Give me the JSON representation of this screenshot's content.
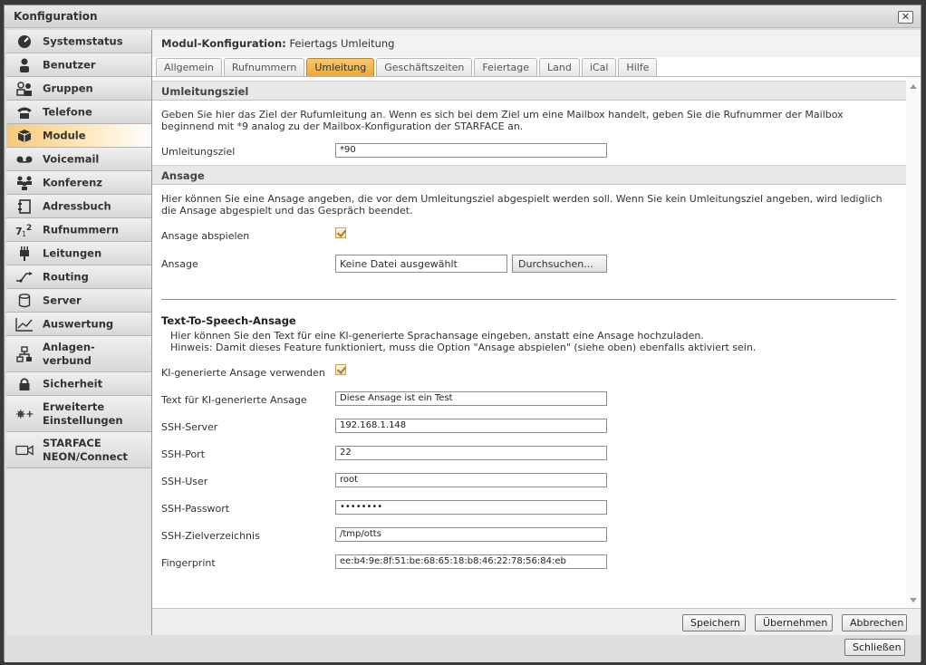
{
  "window": {
    "title": "Konfiguration",
    "close_glyph": "✕"
  },
  "sidebar": {
    "items": [
      {
        "label": "Systemstatus",
        "icon": "gauge-icon"
      },
      {
        "label": "Benutzer",
        "icon": "user-icon"
      },
      {
        "label": "Gruppen",
        "icon": "group-icon"
      },
      {
        "label": "Telefone",
        "icon": "phone-icon"
      },
      {
        "label": "Module",
        "icon": "module-icon",
        "active": true
      },
      {
        "label": "Voicemail",
        "icon": "voicemail-icon"
      },
      {
        "label": "Konferenz",
        "icon": "conference-icon"
      },
      {
        "label": "Adressbuch",
        "icon": "addressbook-icon"
      },
      {
        "label": "Rufnummern",
        "icon": "numbers-icon"
      },
      {
        "label": "Leitungen",
        "icon": "line-icon"
      },
      {
        "label": "Routing",
        "icon": "routing-icon"
      },
      {
        "label": "Server",
        "icon": "server-icon"
      },
      {
        "label": "Auswertung",
        "icon": "chart-icon"
      },
      {
        "label_line1": "Anlagen-",
        "label_line2": "verbund",
        "icon": "network-icon"
      },
      {
        "label": "Sicherheit",
        "icon": "lock-icon"
      },
      {
        "label_line1": "Erweiterte",
        "label_line2": "Einstellungen",
        "icon": "advanced-settings-icon"
      },
      {
        "label_line1": "STARFACE",
        "label_line2": "NEON/Connect",
        "icon": "video-icon"
      }
    ]
  },
  "header": {
    "prefix": "Modul-Konfiguration:",
    "module_name": "Feiertags Umleitung"
  },
  "tabs": [
    {
      "label": "Allgemein"
    },
    {
      "label": "Rufnummern"
    },
    {
      "label": "Umleitung",
      "active": true
    },
    {
      "label": "Geschäftszeiten"
    },
    {
      "label": "Feiertage"
    },
    {
      "label": "Land"
    },
    {
      "label": "iCal"
    },
    {
      "label": "Hilfe"
    }
  ],
  "umleitung": {
    "section_title": "Umleitungsziel",
    "desc_line1": "Geben Sie hier das Ziel der Rufumleitung an. Wenn es sich bei dem Ziel um eine Mailbox handelt, geben Sie die Rufnummer der Mailbox",
    "desc_line2": "beginnend mit *9 analog zu der Mailbox-Konfiguration der STARFACE an.",
    "field_label": "Umleitungsziel",
    "field_value": "*90"
  },
  "ansage": {
    "section_title": "Ansage",
    "desc_line1": "Hier können Sie eine Ansage angeben, die vor dem Umleitungsziel abgespielt werden soll. Wenn Sie kein Umleitungsziel angeben, wird lediglich",
    "desc_line2": "die Ansage abgespielt und das Gespräch beendet.",
    "play_label": "Ansage abspielen",
    "play_checked": true,
    "file_label": "Ansage",
    "file_value": "Keine Datei ausgewählt",
    "browse_label": "Durchsuchen..."
  },
  "tts": {
    "title": "Text-To-Speech-Ansage",
    "desc_line1": "Hier können Sie den Text für eine KI-generierte Sprachansage eingeben, anstatt eine Ansage hochzuladen.",
    "desc_line2": "Hinweis: Damit dieses Feature funktioniert, muss die Option \"Ansage abspielen\" (siehe oben) ebenfalls aktiviert sein.",
    "use_label": "KI-generierte Ansage verwenden",
    "use_checked": true,
    "fields": [
      {
        "label": "Text für KI-generierte Ansage",
        "value": "Diese Ansage ist ein Test"
      },
      {
        "label": "SSH-Server",
        "value": "192.168.1.148"
      },
      {
        "label": "SSH-Port",
        "value": "22"
      },
      {
        "label": "SSH-User",
        "value": "root"
      },
      {
        "label": "SSH-Passwort",
        "value": "••••••••"
      },
      {
        "label": "SSH-Zielverzeichnis",
        "value": "/tmp/otts"
      },
      {
        "label": "Fingerprint",
        "value": "ee:b4:9e:8f:51:be:68:65:18:b8:46:22:78:56:84:eb"
      }
    ]
  },
  "footer": {
    "save": "Speichern",
    "apply": "Übernehmen",
    "cancel": "Abbrechen"
  },
  "bottom": {
    "close": "Schließen"
  },
  "colors": {
    "accent": "#f0b042",
    "active_nav": "#fde3b0"
  }
}
